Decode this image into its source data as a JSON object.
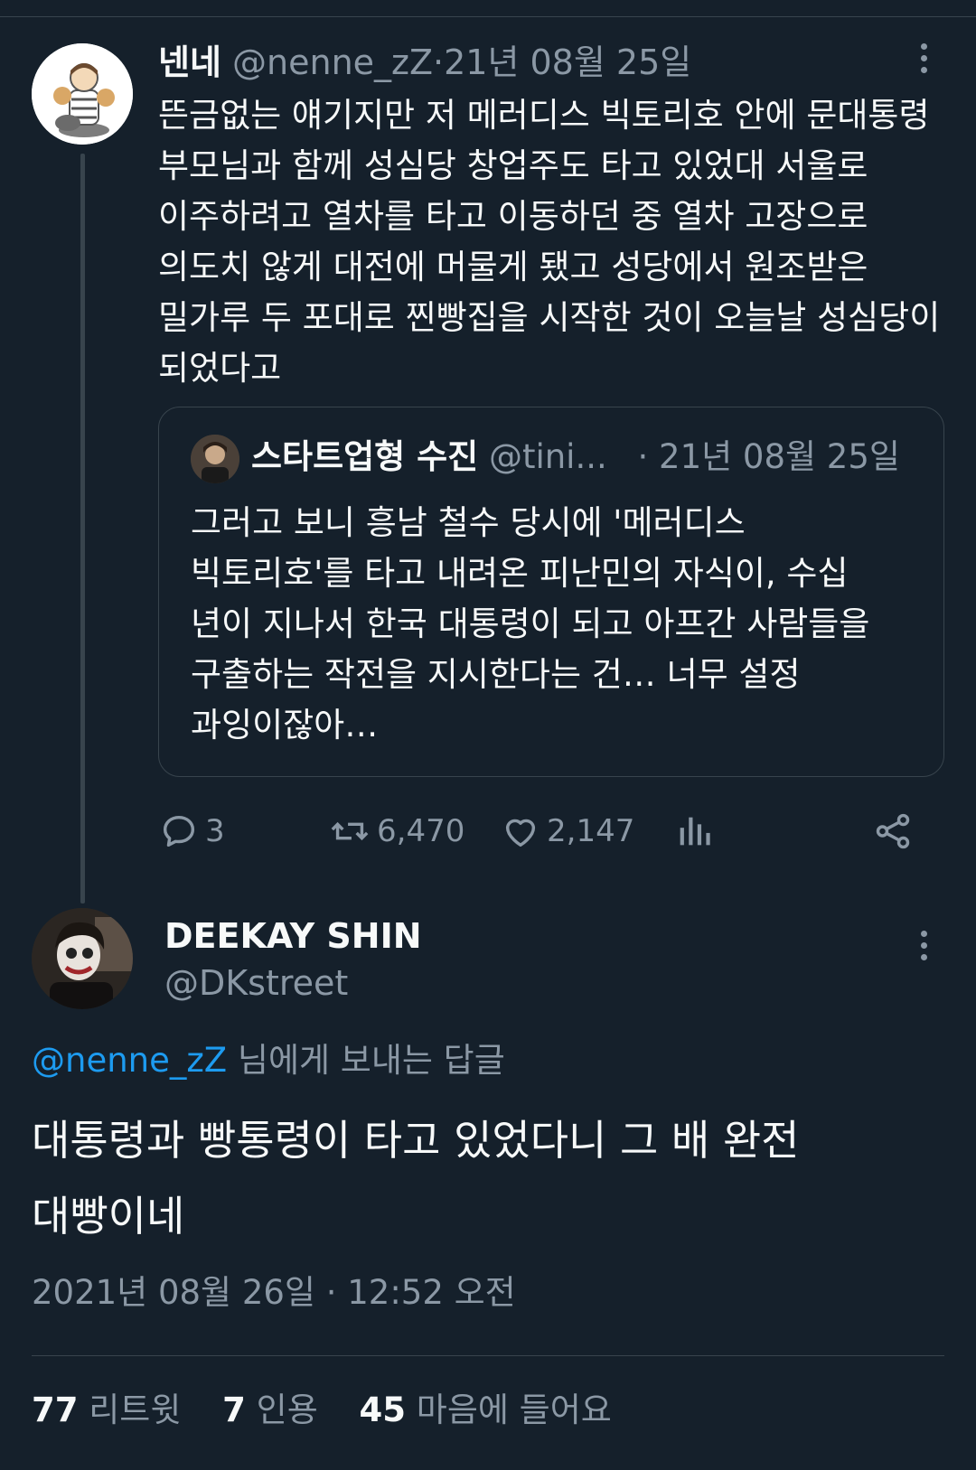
{
  "original_tweet": {
    "display_name": "넨네",
    "handle": "@nenne_zZ",
    "separator": "·",
    "date": "21년 08월 25일",
    "avatar_icon": "cartoon-avatar-icon",
    "text": "뜬금없는 얘기지만 저 메러디스 빅토리호 안에 문대통령 부모님과 함께 성심당 창업주도 타고 있었대 서울로 이주하려고 열차를 타고 이동하던 중 열차 고장으로 의도치 않게 대전에 머물게 됐고 성당에서 원조받은 밀가루 두 포대로 찐빵집을 시작한 것이 오늘날 성심당이 되었다고",
    "quoted": {
      "display_name": "스타트업형 수진",
      "handle": "@tini...",
      "date": "· 21년 08월 25일",
      "text": "그러고 보니 흥남 철수 당시에 '메러디스 빅토리호'를 타고 내려온 피난민의 자식이, 수십 년이 지나서 한국 대통령이 되고 아프간 사람들을 구출하는 작전을 지시한다는 건… 너무 설정 과잉이잖아…"
    },
    "actions": {
      "replies": "3",
      "retweets": "6,470",
      "likes": "2,147"
    }
  },
  "reply_tweet": {
    "display_name": "DEEKAY SHIN",
    "handle": "@DKstreet",
    "reply_to_mention": "@nenne_zZ",
    "reply_to_suffix": " 님에게 보내는 답글",
    "text": "대통령과 빵통령이 타고 있었다니 그 배 완전 대빵이네",
    "timestamp": "2021년 08월 26일 · 12:52 오전",
    "stats": {
      "retweets_count": "77",
      "retweets_label": "리트윗",
      "quotes_count": "7",
      "quotes_label": "인용",
      "likes_count": "45",
      "likes_label": "마음에 들어요"
    }
  },
  "colors": {
    "background": "#15202b",
    "text": "#f7f9f9",
    "muted": "#8b98a5",
    "accent": "#1d9bf0",
    "border": "#38444d"
  }
}
